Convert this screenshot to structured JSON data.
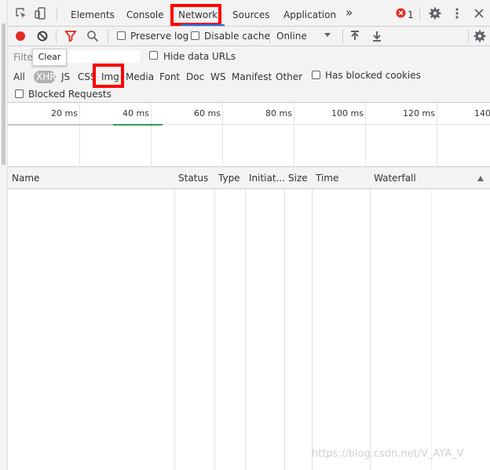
{
  "tabs": [
    {
      "label": "Elements"
    },
    {
      "label": "Console"
    },
    {
      "label": "Network"
    },
    {
      "label": "Sources"
    },
    {
      "label": "Application"
    }
  ],
  "more_tabs_glyph": "»",
  "error_count": "1",
  "toolbar": {
    "preserve_log": "Preserve log",
    "disable_cache": "Disable cache",
    "throttling": "Online"
  },
  "filter": {
    "placeholder": "Filter",
    "tooltip": "Clear",
    "hide_data_urls": "Hide data URLs",
    "types": [
      "All",
      "XHR",
      "JS",
      "CSS",
      "Img",
      "Media",
      "Font",
      "Doc",
      "WS",
      "Manifest",
      "Other"
    ],
    "has_blocked_cookies": "Has blocked cookies",
    "blocked_requests": "Blocked Requests"
  },
  "overview": {
    "ticks": [
      "20 ms",
      "40 ms",
      "60 ms",
      "80 ms",
      "100 ms",
      "120 ms",
      "140"
    ]
  },
  "columns": [
    "Name",
    "Status",
    "Type",
    "Initiat...",
    "Size",
    "Time",
    "Waterfall"
  ],
  "watermark": "https://blog.csdn.net/V_AYA_V",
  "colors": {
    "record_red": "#e32b22",
    "active_tab_blue": "#1a73e8",
    "highlight_red": "#ff0000",
    "timeline_green": "#26a15b"
  }
}
